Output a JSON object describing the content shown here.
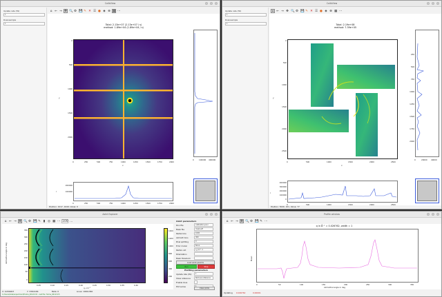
{
  "windows": {
    "tl": {
      "title": "CalibView",
      "side": {
        "label1": "Update rate (Hz)",
        "value1": "1",
        "label2": "Downsample",
        "value2": "1"
      },
      "toolbar": [
        "⌂",
        "←",
        "→",
        "✥",
        "🔍",
        "⚙",
        "💾",
        "✎",
        "✕",
        "☰",
        "●",
        "◈",
        "⊕",
        "▦",
        "⋯"
      ],
      "plot": {
        "title_line1": "Total: 2.13e+07 (2.13e+07 / s)",
        "title_line2": "method: 1.89e+04 (1.89e+04 / s)",
        "x_ticks": [
          "0",
          "250",
          "500",
          "750",
          "1000",
          "1250",
          "1500",
          "1750",
          "2000"
        ],
        "y_ticks": [
          "0",
          "500",
          "1000",
          "1500",
          "2000"
        ],
        "x_label": "x",
        "y_label": "y",
        "right_x_ticks": [
          "0",
          "100000",
          "400000"
        ],
        "bottom_y_ticks": [
          "200000",
          "100000"
        ],
        "bottom_x_ticks": [
          "0",
          "250",
          "500",
          "750",
          "1000",
          "1250",
          "1500",
          "1750",
          "2000"
        ],
        "bottom_y_label": "I",
        "bottom_x_label": "x"
      },
      "status": "Position: 1017, 1049, Value: 0"
    },
    "tr": {
      "title": "CalibView",
      "side": {
        "label1": "Update rate (Hz)",
        "value1": "1",
        "label2": "Downsample",
        "value2": "1"
      },
      "toolbar": [
        "⌂",
        "←",
        "→",
        "✥",
        "🔍",
        "⚙",
        "💾",
        "✎",
        "✕",
        "☰",
        "●",
        "◈",
        "⊕",
        "▦",
        "⋯"
      ],
      "plot": {
        "title_line1": "Total: 2.19e+08",
        "title_line2": "method: 7.39e+05",
        "x_ticks": [
          "0",
          "500",
          "1000",
          "1500",
          "2000",
          "2500"
        ],
        "y_ticks": [
          "0",
          "500",
          "1000",
          "1500",
          "2000",
          "2500"
        ],
        "x_label": "x",
        "y_label": "y",
        "right_y_ticks": [
          "250",
          "500",
          "750",
          "1000",
          "1250",
          "1500",
          "1750",
          "2000"
        ],
        "right_x_ticks": [
          "0",
          "20000",
          "40000"
        ],
        "bottom_y_ticks": [
          "400000",
          "300000",
          "200000",
          "100000",
          "0"
        ],
        "bottom_x_ticks": [
          "0",
          "500",
          "1000",
          "1500",
          "2000",
          "2500"
        ],
        "bottom_y_label": "I",
        "bottom_x_label": "x"
      },
      "status": "Position: 5040, 101, Value: 77"
    },
    "bl": {
      "title": "AzInt Explorer",
      "toolbar": [
        "⌂",
        "←",
        "→",
        "✥",
        "🔍",
        "⚙",
        "💾",
        "✎",
        "▮",
        "◎",
        "▦",
        "⋯",
        "100",
        "…"
      ],
      "plot": {
        "y_ticks": [
          "350",
          "300",
          "250",
          "200",
          "150",
          "100",
          "50",
          "0"
        ],
        "x_ticks": [
          "0.05",
          "0.10",
          "0.15",
          "0.20",
          "0.25",
          "0.30",
          "0.35",
          "0.40"
        ],
        "x_label": "q, nm⁻¹",
        "y_label": "Azimuthal angle in deg",
        "cbar_ticks": [
          "1400",
          "1200",
          "1000",
          "800",
          "600",
          "400",
          "200"
        ]
      },
      "panel": {
        "heading1": "Azint parameters",
        "rows": [
          {
            "label": "Poni file",
            "value": "calibration.poni"
          },
          {
            "label": "Mask file",
            "value": "mask.edf"
          },
          {
            "label": "Radial bins",
            "value": "1000"
          },
          {
            "label": "Azimuth bins",
            "value": "360"
          },
          {
            "label": "Pixel splitting",
            "value": "0"
          },
          {
            "label": "Error model",
            "value": "None"
          },
          {
            "label": "Radial unit",
            "value": "q_nm^-1"
          },
          {
            "label": "Polarization",
            "value": ""
          },
          {
            "label": "Mask threshold",
            "value": ""
          }
        ],
        "load_button": "Load azint params",
        "run_label": "Run",
        "stop_label": "Stop",
        "heading2": "Plotting parameters",
        "rows2": [
          {
            "label": "Update rate (Hz)",
            "value": "1"
          },
          {
            "label": "Show reference",
            "value": "Remove reference"
          },
          {
            "label": "Enable lines",
            "value": ""
          },
          {
            "label": "Plot series",
            "value": "1"
          }
        ],
        "clear_button": "Clear plots"
      },
      "status": {
        "x_label": "X:",
        "x_value": "0.056923",
        "y_label": "Y:",
        "y_value": "338.6184",
        "beta_label": "Beta:",
        "beta_value": "0",
        "lines_label": "Lines:",
        "lines_value": "1000x360",
        "path": "C:/Users/data/experiment/frame_00123.h5 - last file: frame_00123.h5"
      }
    },
    "br": {
      "title": "Profile window",
      "toolbar": [
        "⌂",
        "←",
        "→",
        "✥",
        "🔍",
        "⚙",
        "💾",
        "✎",
        "⋯"
      ],
      "plot": {
        "title": "q in Å⁻¹ = 0.026762, width = 1",
        "x_ticks": [
          "0",
          "50",
          "100",
          "150",
          "200",
          "250",
          "300",
          "350"
        ],
        "y_label": "Mean",
        "x_label": "Azimuthal angle in deg"
      },
      "status": {
        "left": "Updating",
        "value": "0.026762",
        "value2": "0.00001"
      }
    }
  },
  "colors": {
    "viridis_dark": "#3b0f6f",
    "orange_stripe": "#fdb32f",
    "profile_line": "#e86be0",
    "run_green": "#3cc03c",
    "stop_red": "#e03c3c",
    "plot_blue": "#3b5bdb"
  }
}
